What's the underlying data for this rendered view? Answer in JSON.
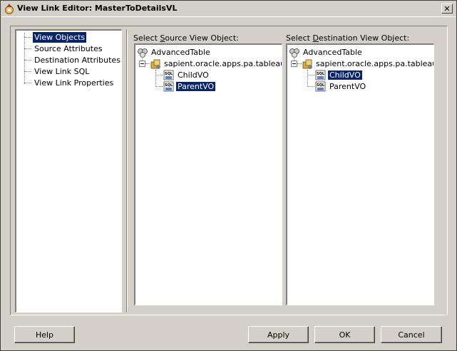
{
  "window": {
    "title": "View Link Editor: MasterToDetailsVL",
    "close_glyph": "✕"
  },
  "nav": {
    "items": [
      {
        "label": "View Objects",
        "selected": true
      },
      {
        "label": "Source Attributes",
        "selected": false
      },
      {
        "label": "Destination Attributes",
        "selected": false
      },
      {
        "label": "View Link SQL",
        "selected": false
      },
      {
        "label": "View Link Properties",
        "selected": false
      }
    ]
  },
  "source": {
    "label_pre": "Select ",
    "label_mnemonic": "S",
    "label_post": "ource View Object:",
    "root": "AdvancedTable",
    "package": "sapient.oracle.apps.pa.tableaudit.s",
    "children": [
      {
        "label": "ChildVO",
        "selected": false
      },
      {
        "label": "ParentVO",
        "selected": true
      }
    ]
  },
  "destination": {
    "label_pre": "Select ",
    "label_mnemonic": "D",
    "label_post": "estination View Object:",
    "root": "AdvancedTable",
    "package": "sapient.oracle.apps.pa.tableaudit.s",
    "children": [
      {
        "label": "ChildVO",
        "selected": true
      },
      {
        "label": "ParentVO",
        "selected": false
      }
    ]
  },
  "buttons": {
    "help": "Help",
    "apply": "Apply",
    "ok": "OK",
    "cancel": "Cancel"
  },
  "colors": {
    "selection": "#0a246a",
    "face": "#d4d0c8"
  }
}
